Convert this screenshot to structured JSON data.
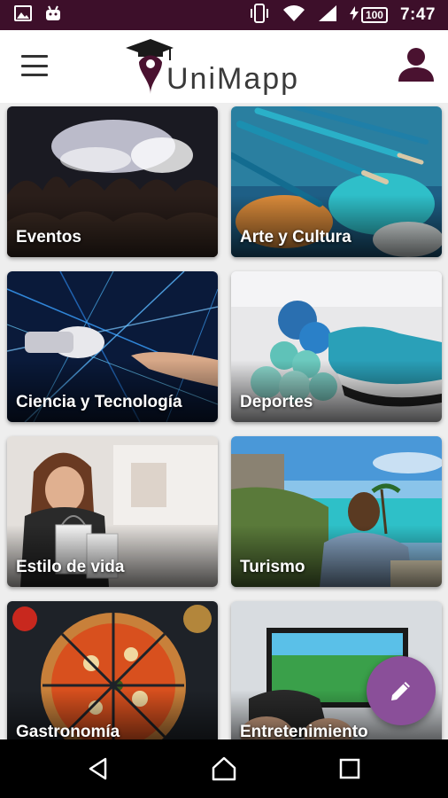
{
  "status_bar": {
    "time": "7:47",
    "battery": "100",
    "icons": [
      "image-icon",
      "android-icon",
      "vibrate-icon",
      "wifi-icon",
      "signal-icon",
      "charging-icon"
    ]
  },
  "app_bar": {
    "title": "UniMapp",
    "menu_icon": "menu-icon",
    "profile_icon": "person-icon"
  },
  "categories": [
    {
      "label": "Eventos"
    },
    {
      "label": "Arte y Cultura"
    },
    {
      "label": "Ciencia y Tecnología"
    },
    {
      "label": "Deportes"
    },
    {
      "label": "Estilo de vida"
    },
    {
      "label": "Turismo"
    },
    {
      "label": "Gastronomía"
    },
    {
      "label": "Entretenimiento"
    }
  ],
  "fab": {
    "icon": "edit-icon"
  },
  "nav_bar": {
    "buttons": [
      "back-icon",
      "home-icon",
      "recents-icon"
    ]
  },
  "colors": {
    "status_bar": "#3d0f2a",
    "brand": "#4a1230",
    "fab": "#8a4f99"
  }
}
